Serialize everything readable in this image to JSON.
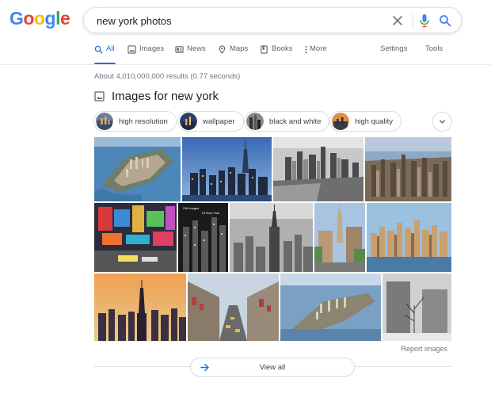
{
  "logo": {
    "letters": [
      "G",
      "o",
      "o",
      "g",
      "l",
      "e"
    ],
    "colors": [
      "#4285F4",
      "#EA4335",
      "#FBBC05",
      "#4285F4",
      "#34A853",
      "#EA4335"
    ]
  },
  "search": {
    "query": "new york photos"
  },
  "tabs": [
    {
      "label": "All",
      "icon": "search-icon",
      "active": true
    },
    {
      "label": "Images",
      "icon": "image-icon",
      "active": false
    },
    {
      "label": "News",
      "icon": "news-icon",
      "active": false
    },
    {
      "label": "Maps",
      "icon": "map-pin-icon",
      "active": false
    },
    {
      "label": "Books",
      "icon": "book-icon",
      "active": false
    },
    {
      "label": "More",
      "icon": "more-vertical-icon",
      "active": false
    }
  ],
  "tools": {
    "settings": "Settings",
    "tools": "Tools"
  },
  "result_stats": "About 4,010,000,000 results (0.77 seconds)",
  "images_section": {
    "heading": "Images for new york",
    "chips": [
      "high resolution",
      "wallpaper",
      "black and white",
      "high quality"
    ],
    "captions": {
      "old_images": "Old images",
      "of_new_york": "Of New York"
    },
    "report_label": "Report images",
    "view_all_label": "View all"
  },
  "colors": {
    "accent": "#1a73e8",
    "text_secondary": "#70757a"
  }
}
